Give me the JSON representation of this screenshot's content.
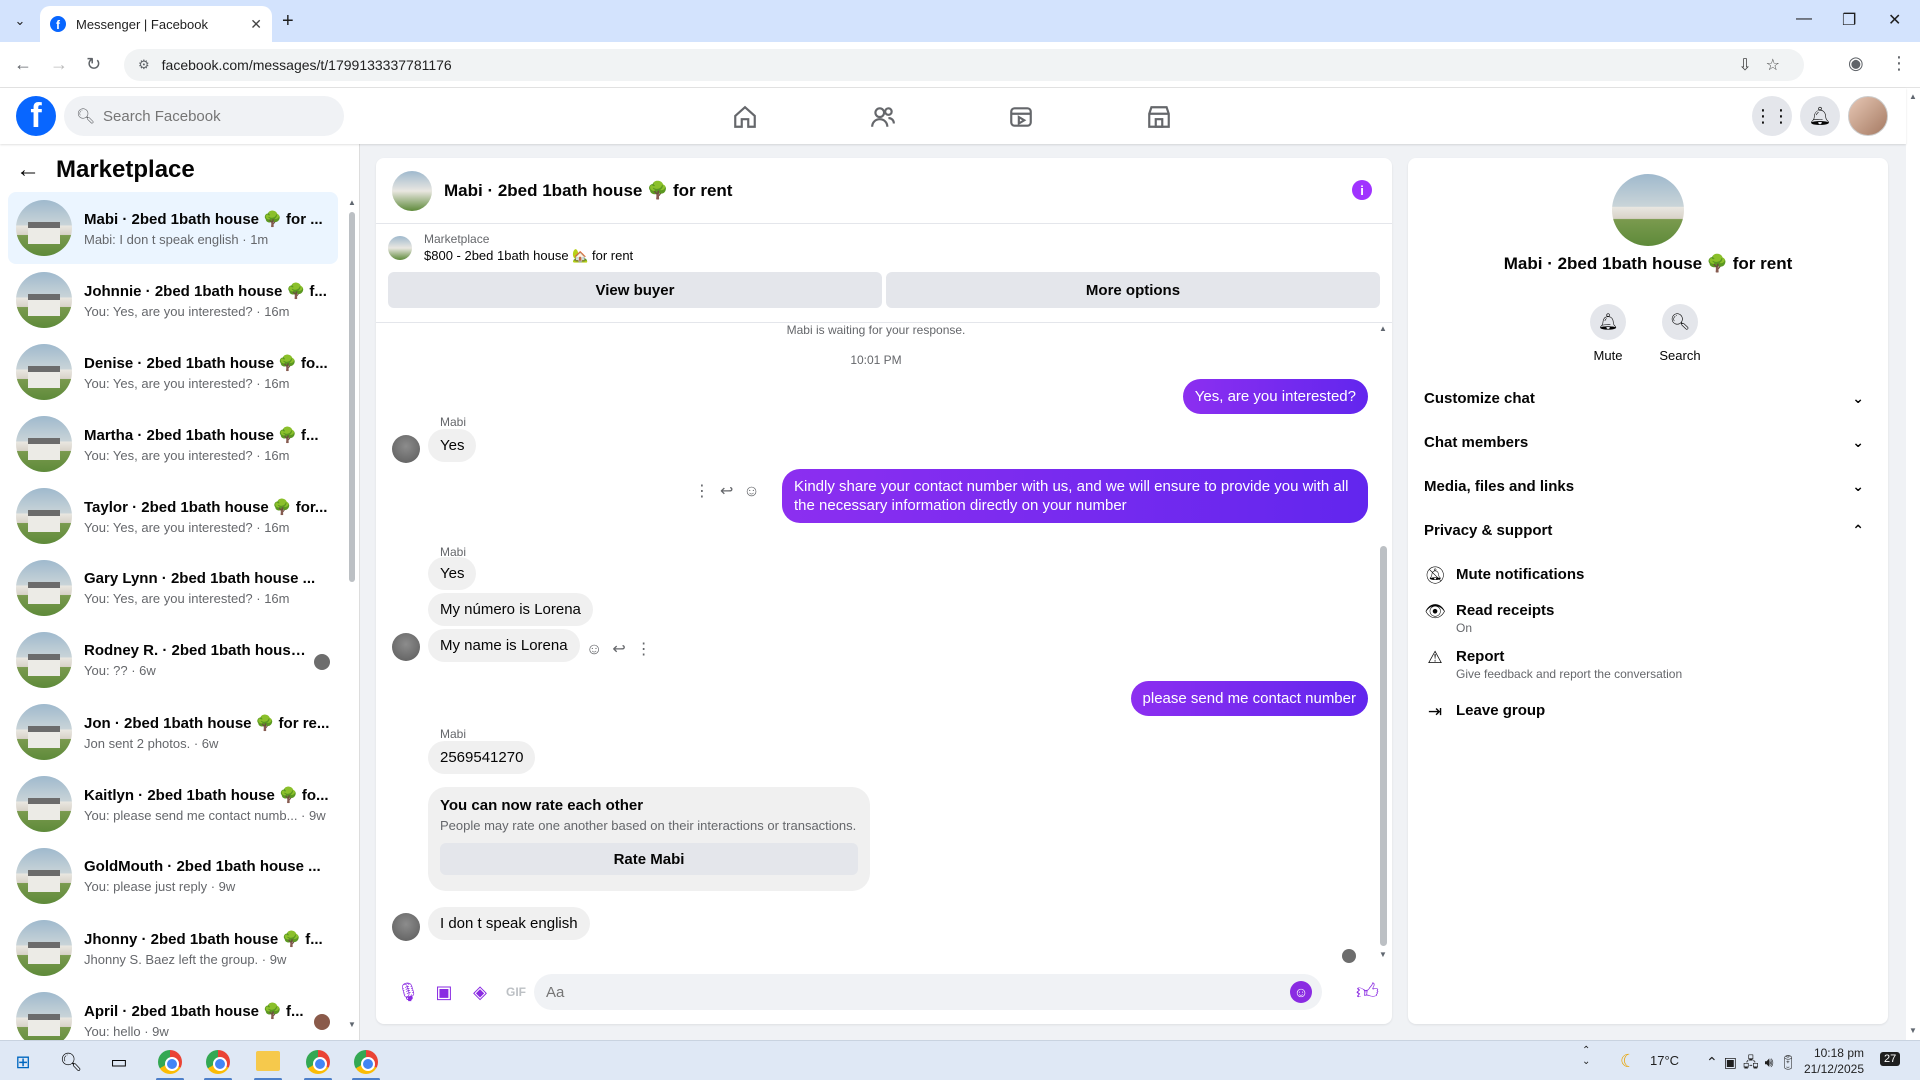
{
  "browser": {
    "tab_title": "Messenger | Facebook",
    "url": "facebook.com/messages/t/1799133337781176"
  },
  "header": {
    "search_placeholder": "Search Facebook"
  },
  "left": {
    "title": "Marketplace",
    "conversations": [
      {
        "name": "Mabi · 2bed 1bath house 🌳 for ...",
        "preview": "Mabi: I don t speak english · 1m",
        "active": true
      },
      {
        "name": "Johnnie · 2bed 1bath house 🌳 f...",
        "preview": "You: Yes, are you interested? · 16m"
      },
      {
        "name": "Denise · 2bed 1bath house 🌳 fo...",
        "preview": "You: Yes, are you interested? · 16m"
      },
      {
        "name": "Martha · 2bed 1bath house 🌳 f...",
        "preview": "You: Yes, are you interested? · 16m"
      },
      {
        "name": "Taylor · 2bed 1bath house 🌳 for...",
        "preview": "You: Yes, are you interested? · 16m"
      },
      {
        "name": "Gary Lynn · 2bed 1bath house ...",
        "preview": "You: Yes, are you interested? · 16m"
      },
      {
        "name": "Rodney R. · 2bed 1bath house ...",
        "preview": "You: ?? · 6w"
      },
      {
        "name": "Jon · 2bed 1bath house 🌳 for re...",
        "preview": "Jon sent 2 photos. · 6w"
      },
      {
        "name": "Kaitlyn · 2bed 1bath house 🌳 fo...",
        "preview": "You: please send me contact numb... · 9w"
      },
      {
        "name": "GoldMouth · 2bed 1bath house ...",
        "preview": "You: please just reply · 9w"
      },
      {
        "name": "Jhonny · 2bed 1bath house 🌳 f...",
        "preview": "Jhonny S. Baez left the group. · 9w"
      },
      {
        "name": "April · 2bed 1bath house 🌳 f...",
        "preview": "You: hello · 9w"
      }
    ]
  },
  "chat": {
    "title": "Mabi · 2bed 1bath house 🌳 for rent",
    "marketplace_label": "Marketplace",
    "listing": "$800 - 2bed 1bath house 🏡 for rent",
    "view_buyer": "View buyer",
    "more_options": "More options",
    "waiting": "Mabi is waiting for your response.",
    "timestamp": "10:01 PM",
    "sender": "Mabi",
    "msg_out_1": "Yes, are you interested?",
    "msg_in_1": "Yes",
    "msg_out_2": "Kindly share your contact number with us, and we will ensure to provide you with all the necessary information directly on your number",
    "msg_in_2": "Yes",
    "msg_in_3": "My número is Lorena",
    "msg_in_4": "My name is Lorena",
    "msg_out_3": "please send me contact number",
    "msg_in_5": "2569541270",
    "rate_title": "You can now rate each other",
    "rate_sub": "People may rate one another based on their interactions or transactions.",
    "rate_btn": "Rate Mabi",
    "msg_in_6": "I  don t speak english",
    "composer_placeholder": "Aa"
  },
  "right": {
    "name": "Mabi · 2bed 1bath house 🌳 for rent",
    "mute": "Mute",
    "search": "Search",
    "customize": "Customize chat",
    "members": "Chat members",
    "media": "Media, files and links",
    "privacy": "Privacy & support",
    "mute_notif": "Mute notifications",
    "read_receipts": "Read receipts",
    "read_receipts_state": "On",
    "report": "Report",
    "report_sub": "Give feedback and report the conversation",
    "leave": "Leave group"
  },
  "taskbar": {
    "weather": "17°C",
    "time": "10:18 pm",
    "date": "21/12/2025",
    "notif_count": "27"
  }
}
